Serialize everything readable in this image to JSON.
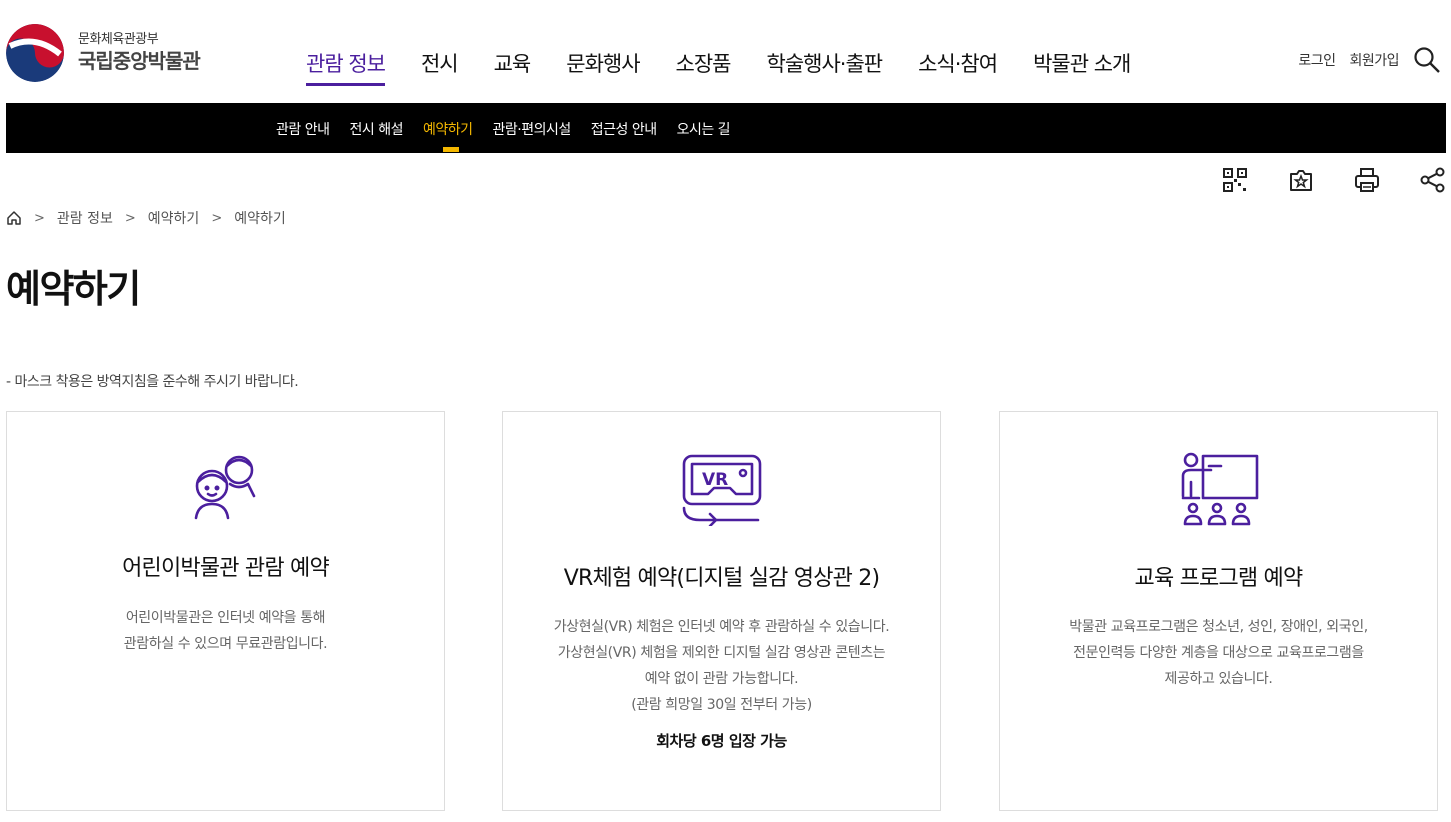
{
  "header": {
    "ministry": "문화체육관광부",
    "museum": "국립중앙박물관",
    "nav": [
      "관람 정보",
      "전시",
      "교육",
      "문화행사",
      "소장품",
      "학술행사·출판",
      "소식·참여",
      "박물관 소개"
    ],
    "login": "로그인",
    "signup": "회원가입",
    "icons": [
      "search-icon"
    ]
  },
  "subnav": [
    "관람 안내",
    "전시 해설",
    "예약하기",
    "관람·편의시설",
    "접근성 안내",
    "오시는 길"
  ],
  "tools": [
    "qr-code-icon",
    "bookmark-icon",
    "print-icon",
    "share-icon"
  ],
  "breadcrumb": [
    "관람 정보",
    "예약하기",
    "예약하기"
  ],
  "page_title": "예약하기",
  "notice": "- 마스크 착용은 방역지침을 준수해 주시기 바랍니다.",
  "cards": [
    {
      "title": "어린이박물관 관람 예약",
      "desc": [
        "어린이박물관은 인터넷 예약을 통해",
        "관람하실 수 있으며 무료관람입니다."
      ],
      "icon": "children-icon"
    },
    {
      "title": "VR체험 예약(디지털 실감 영상관 2)",
      "desc": [
        "가상현실(VR) 체험은 인터넷 예약 후 관람하실 수 있습니다.",
        "가상현실(VR) 체험을 제외한 디지털 실감 영상관 콘텐츠는",
        "예약 없이 관람 가능합니다.",
        "(관람 희망일 30일 전부터 가능)"
      ],
      "note": "회차당 6명 입장 가능",
      "icon": "vr-headset-icon"
    },
    {
      "title": "교육 프로그램 예약",
      "desc": [
        "박물관 교육프로그램은 청소년, 성인, 장애인, 외국인,",
        "전문인력등 다양한 계층을 대상으로 교육프로그램을",
        "제공하고 있습니다."
      ],
      "icon": "education-icon"
    }
  ],
  "colors": {
    "accent": "#4b1f9e",
    "subnav_active": "#f5b800",
    "icon_purple": "#4b1f9e"
  }
}
